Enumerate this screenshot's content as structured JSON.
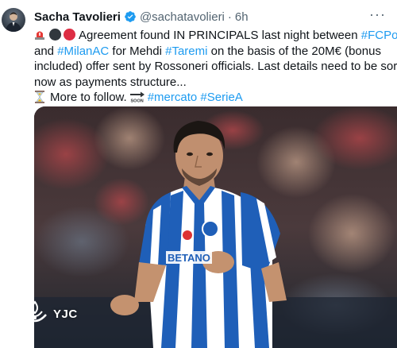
{
  "tweet": {
    "author": {
      "display_name": "Sacha Tavolieri",
      "handle": "@sachatavolieri",
      "verified_icon": "verified-badge-icon",
      "avatar_icon": "user-avatar"
    },
    "separator": "·",
    "time": "6h",
    "more_icon": "more-options-icon",
    "lines": {
      "line1": {
        "emojis": [
          "siren-icon",
          "black-circle-icon",
          "red-circle-icon"
        ],
        "text_before": "Agreement found IN PRINCIPALS last night between ",
        "hashtag": "#FCPorto"
      },
      "line2": {
        "text_before": "and ",
        "hashtag1": "#MilanAC",
        "text_middle": " for Mehdi ",
        "hashtag2": "#Taremi",
        "text_after": " on the basis of the 20M€ (bonus"
      },
      "line3": {
        "text": "included) offer sent by Rossoneri officials. Last details need to be sorted"
      },
      "line4": {
        "text": "now as payments structure..."
      },
      "line5": {
        "emoji": "hourglass-icon",
        "text_before": "More to follow.",
        "soon_icon": "soon-arrow-icon",
        "hashtag1": "#mercato",
        "hashtag2": "#SerieA"
      }
    },
    "media": {
      "image": "football-player-photo",
      "sponsor_text": "BETANO",
      "watermark": "YJC",
      "watermark_logo": "yjc-logo-icon"
    },
    "colors": {
      "hashtag": "#1d9bf0",
      "secondary_text": "#536471",
      "verified": "#1d9bf0",
      "jersey_blue": "#1f5fb8"
    }
  }
}
